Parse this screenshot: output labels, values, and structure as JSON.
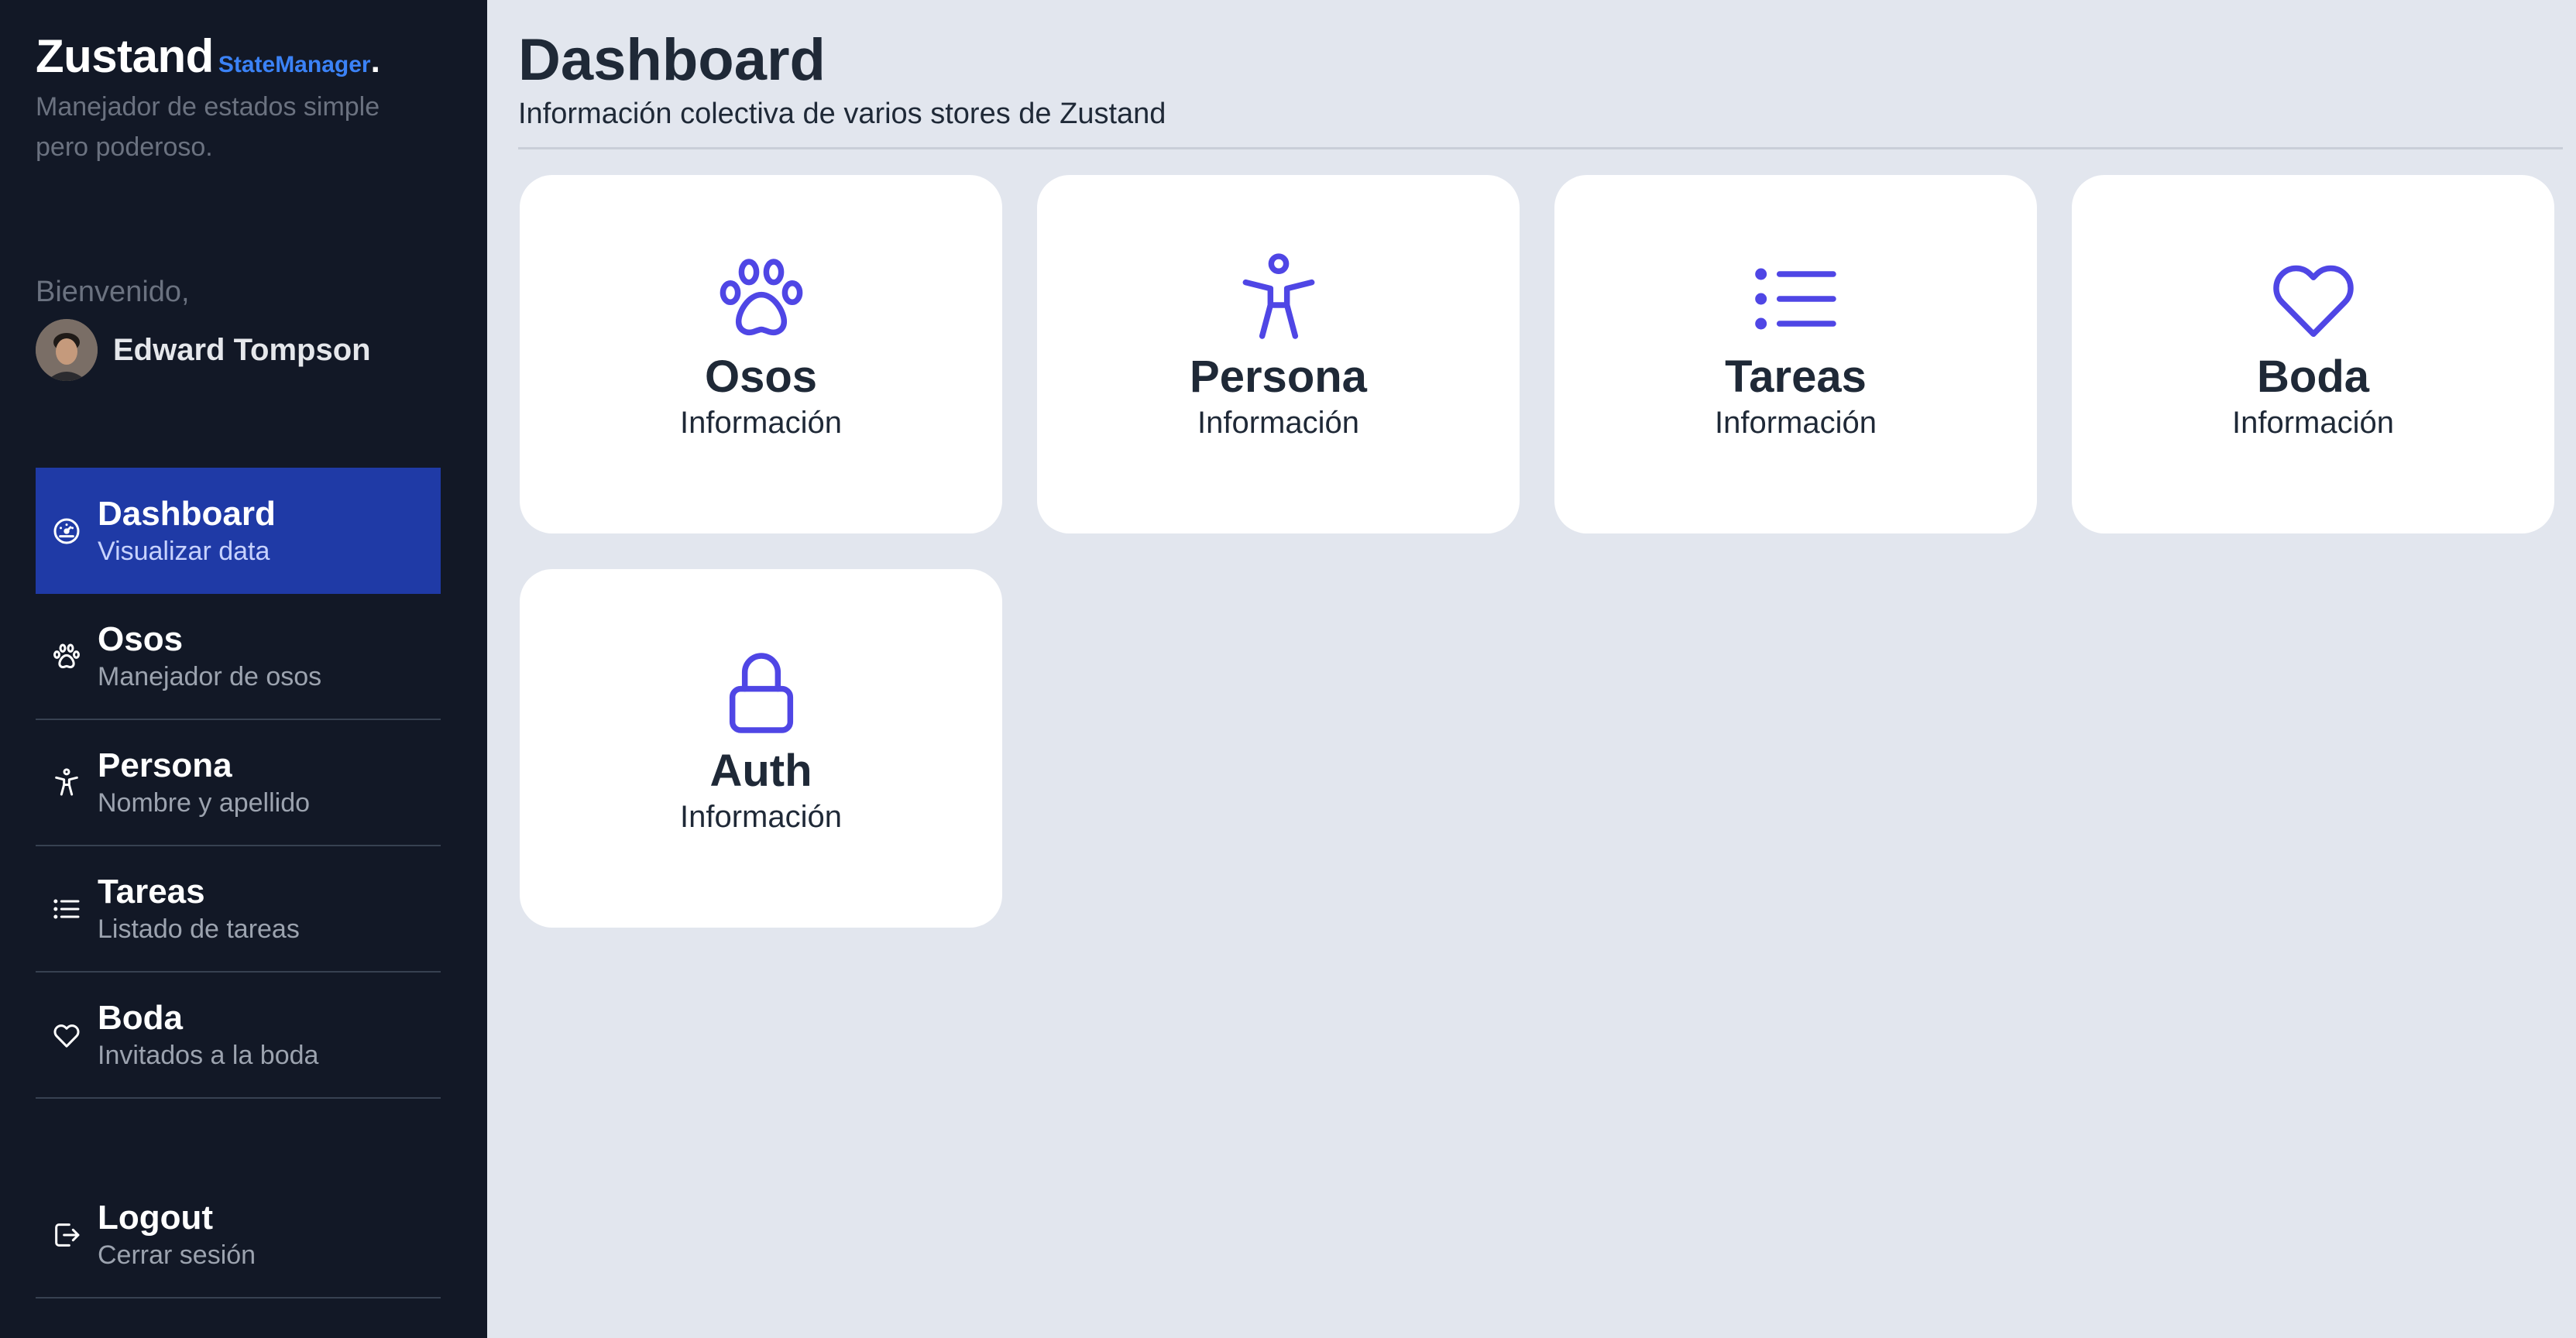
{
  "brand": {
    "name": "Zustand",
    "sub": "StateManager",
    "dot": ".",
    "tagline": "Manejador de estados simple pero poderoso."
  },
  "user": {
    "welcome": "Bienvenido,",
    "name": "Edward Tompson"
  },
  "nav": [
    {
      "title": "Dashboard",
      "subtitle": "Visualizar data",
      "icon": "dashboard-gauge-icon",
      "active": true
    },
    {
      "title": "Osos",
      "subtitle": "Manejador de osos",
      "icon": "paw-icon"
    },
    {
      "title": "Persona",
      "subtitle": "Nombre y apellido",
      "icon": "person-icon"
    },
    {
      "title": "Tareas",
      "subtitle": "Listado de tareas",
      "icon": "list-icon"
    },
    {
      "title": "Boda",
      "subtitle": "Invitados a la boda",
      "icon": "heart-icon"
    }
  ],
  "logout": {
    "title": "Logout",
    "subtitle": "Cerrar sesión",
    "icon": "logout-icon"
  },
  "page": {
    "title": "Dashboard",
    "subtitle": "Información colectiva de varios stores de Zustand"
  },
  "cards": [
    {
      "title": "Osos",
      "info": "Información",
      "icon": "paw-icon"
    },
    {
      "title": "Persona",
      "info": "Información",
      "icon": "person-icon"
    },
    {
      "title": "Tareas",
      "info": "Información",
      "icon": "list-icon"
    },
    {
      "title": "Boda",
      "info": "Información",
      "icon": "heart-icon"
    },
    {
      "title": "Auth",
      "info": "Información",
      "icon": "lock-icon"
    }
  ],
  "colors": {
    "sidebar": "#121826",
    "active": "#1f3aa6",
    "accent": "#4f46e5",
    "brandSub": "#3b82f6",
    "background": "#e2e6ee"
  }
}
